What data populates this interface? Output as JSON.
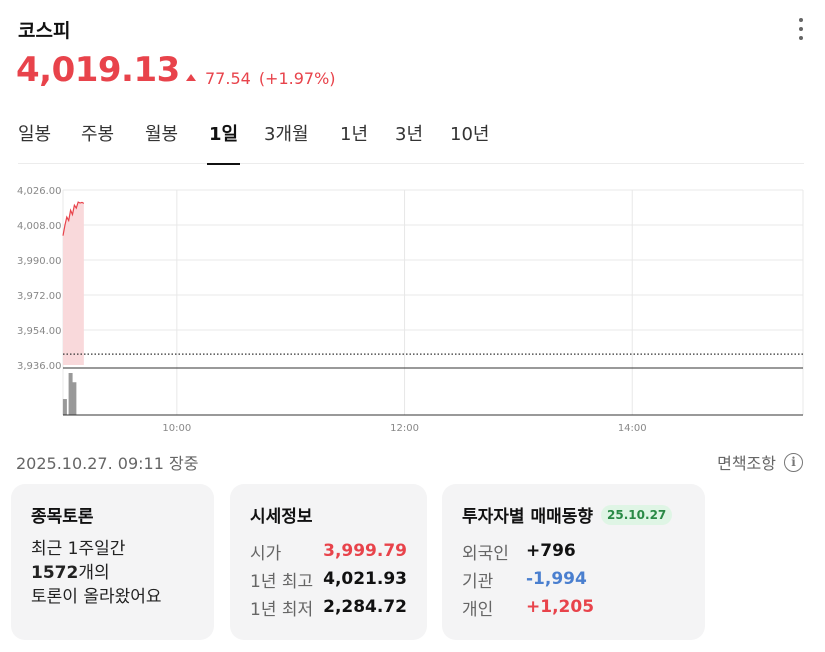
{
  "header": {
    "title": "코스피",
    "price": "4,019.13",
    "change_amount": "77.54",
    "change_percent": "(+1.97%)",
    "accent_color": "#e8434b"
  },
  "tabs": [
    {
      "label": "일봉",
      "active": false
    },
    {
      "label": "주봉",
      "active": false
    },
    {
      "label": "월봉",
      "active": false
    },
    {
      "label": "1일",
      "active": true
    },
    {
      "label": "3개월",
      "active": false
    },
    {
      "label": "1년",
      "active": false
    },
    {
      "label": "3년",
      "active": false
    },
    {
      "label": "10년",
      "active": false
    }
  ],
  "chart_data": {
    "type": "line",
    "y_ticks": [
      "4,026.00",
      "4,008.00",
      "3,990.00",
      "3,972.00",
      "3,954.00",
      "3,936.00"
    ],
    "x_ticks": [
      "10:00",
      "12:00",
      "14:00"
    ],
    "ylim": [
      3936,
      4026
    ],
    "session": [
      "09:00",
      "15:30"
    ],
    "previous_close": 3941.59,
    "x": [
      "09:00",
      "09:01",
      "09:02",
      "09:03",
      "09:04",
      "09:05",
      "09:06",
      "09:07",
      "09:08",
      "09:09",
      "09:10",
      "09:11"
    ],
    "values": [
      4002.5,
      4007.8,
      4012.1,
      4010.3,
      4015.6,
      4013.4,
      4018.2,
      4016.7,
      4019.8,
      4019.3,
      4019.6,
      4019.13
    ],
    "volume": [
      {
        "time": "09:01",
        "level": 0.38
      },
      {
        "time": "09:04",
        "level": 1.0
      },
      {
        "time": "09:06",
        "level": 0.78
      }
    ],
    "grid": true,
    "line_color": "#e8434b",
    "area_color": "#f9d9db"
  },
  "status": {
    "timestamp": "2025.10.27. 09:11 장중",
    "disclaimer": "면책조항"
  },
  "discussion": {
    "title": "종목토론",
    "line1": "최근 1주일간",
    "count": "1572",
    "count_suffix": "개의",
    "line3": "토론이 올라왔어요"
  },
  "market_info": {
    "title": "시세정보",
    "rows": [
      {
        "label": "시가",
        "value": "3,999.79"
      },
      {
        "label": "1년 최고",
        "value": "4,021.93"
      },
      {
        "label": "1년 최저",
        "value": "2,284.72"
      }
    ]
  },
  "investors": {
    "title": "투자자별 매매동향",
    "date": "25.10.27",
    "rows": [
      {
        "label": "외국인",
        "value": "+796"
      },
      {
        "label": "기관",
        "value": "-1,994"
      },
      {
        "label": "개인",
        "value": "+1,205"
      }
    ]
  }
}
